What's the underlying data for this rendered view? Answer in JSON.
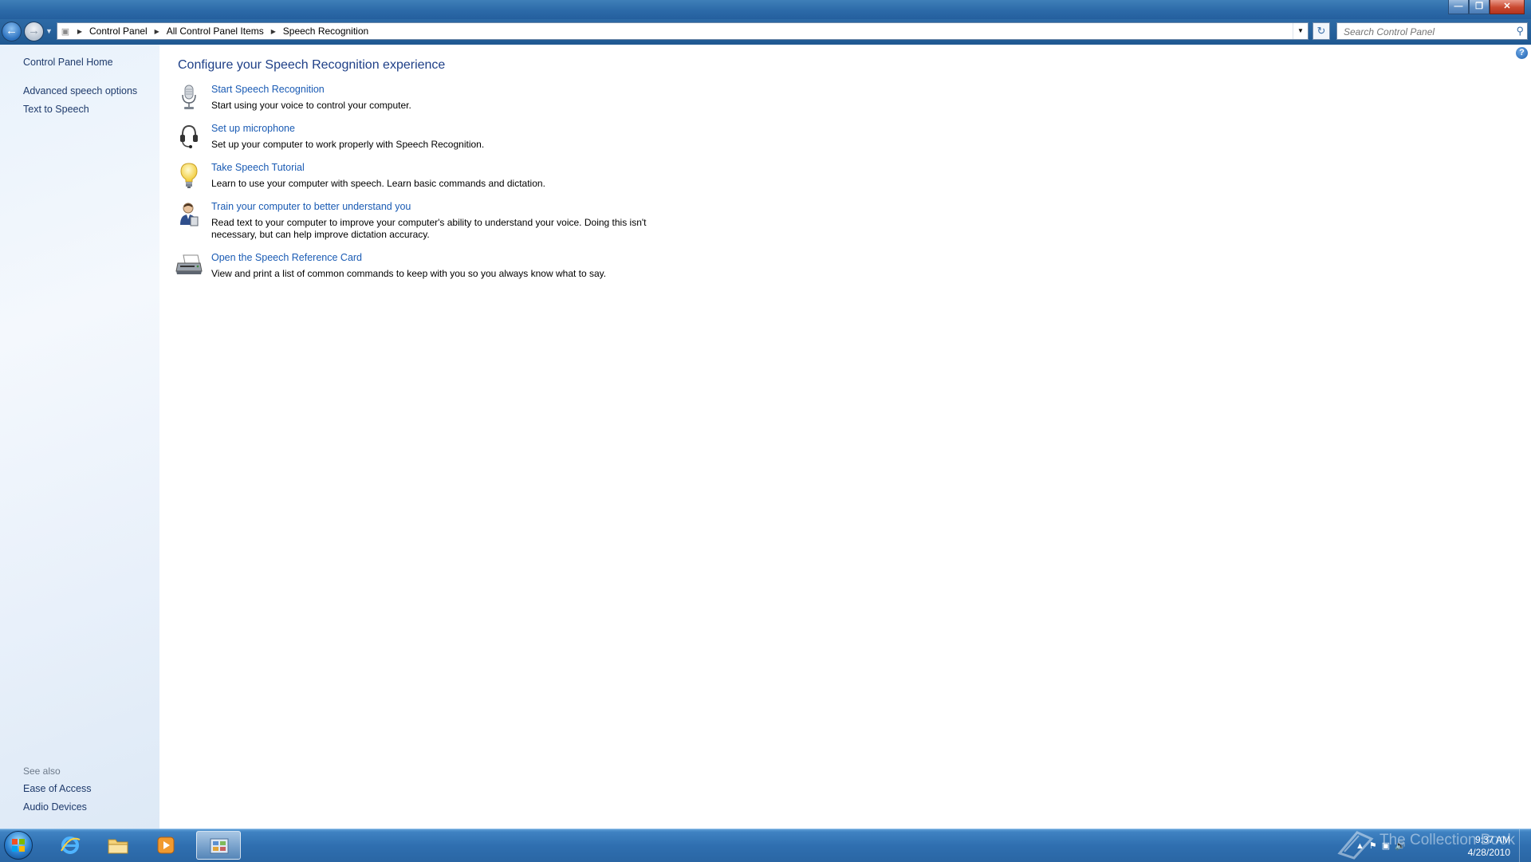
{
  "window": {
    "controls": {
      "minimize": "—",
      "maximize": "❐",
      "close": "✕"
    }
  },
  "address": {
    "crumbs": [
      "Control Panel",
      "All Control Panel Items",
      "Speech Recognition"
    ],
    "search_placeholder": "Search Control Panel"
  },
  "sidebar": {
    "home": "Control Panel Home",
    "links": [
      "Advanced speech options",
      "Text to Speech"
    ],
    "see_also_label": "See also",
    "see_also": [
      "Ease of Access",
      "Audio Devices"
    ]
  },
  "main": {
    "title": "Configure your Speech Recognition experience",
    "tasks": [
      {
        "icon": "microphone-icon",
        "title": "Start Speech Recognition",
        "desc": "Start using your voice to control your computer."
      },
      {
        "icon": "headset-icon",
        "title": "Set up microphone",
        "desc": "Set up your computer to work properly with Speech Recognition."
      },
      {
        "icon": "lightbulb-icon",
        "title": "Take Speech Tutorial",
        "desc": "Learn to use your computer with speech.  Learn basic commands and dictation."
      },
      {
        "icon": "user-train-icon",
        "title": "Train your computer to better understand you",
        "desc": "Read text to your computer to improve your computer's ability to understand your voice.  Doing this isn't necessary, but can help improve dictation accuracy."
      },
      {
        "icon": "printer-icon",
        "title": "Open the Speech Reference Card",
        "desc": "View and print a list of common commands to keep with you so you always know what to say."
      }
    ]
  },
  "taskbar": {
    "items": [
      "internet-explorer-icon",
      "windows-explorer-icon",
      "media-player-icon",
      "control-panel-icon"
    ],
    "time": "9:37 AM",
    "date": "4/28/2010",
    "watermark": "The Collection Book"
  },
  "colors": {
    "link": "#1a5bb4",
    "title": "#1e3f87",
    "sidebar_link": "#1e3a6b",
    "taskbar": "#2f6fb0"
  }
}
